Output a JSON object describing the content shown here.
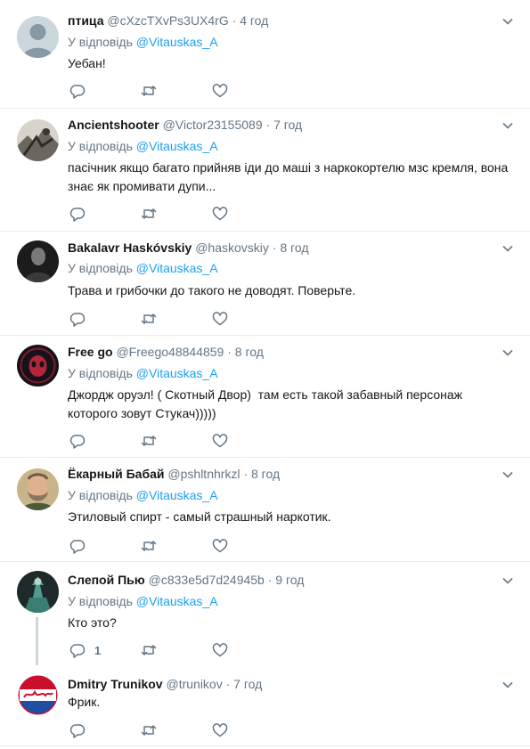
{
  "ui": {
    "reply_prefix": "У відповідь"
  },
  "tweets": [
    {
      "name": "птица",
      "handle": "@cXzcTXvPs3UX4rG",
      "time": "4 год",
      "reply_to": "@Vitauskas_A",
      "text_lines": [
        "Уебан!"
      ],
      "reply_count": "",
      "avatar": "default-avatar"
    },
    {
      "name": "Ancientshooter",
      "handle": "@Victor23155089",
      "time": "7 год",
      "reply_to": "@Vitauskas_A",
      "text_lines": [
        "пасічник якщо багато прийняв іди до маші з наркокортелю мзс кремля, вона",
        "знає як промивати дупи..."
      ],
      "reply_count": "",
      "avatar": "sketch-photo"
    },
    {
      "name": "Bakalavr Haskóvskiy",
      "handle": "@haskovskiy",
      "time": "8 год",
      "reply_to": "@Vitauskas_A",
      "text_lines": [
        "Трава и грибочки до такого не доводят. Поверьте."
      ],
      "reply_count": "",
      "avatar": "dark-portrait"
    },
    {
      "name": "Free go",
      "handle": "@Freego48844859",
      "time": "8 год",
      "reply_to": "@Vitauskas_A",
      "text_lines": [
        "Джордж оруэл! ( Скотный Двор)  там есть такой забавный персонаж",
        "которого зовут Стукач)))))"
      ],
      "reply_count": "",
      "avatar": "red-mask"
    },
    {
      "name": "Ёкарный Бабай",
      "handle": "@pshltnhrkzl",
      "time": "8 год",
      "reply_to": "@Vitauskas_A",
      "text_lines": [
        "Этиловый спирт - самый страшный наркотик."
      ],
      "reply_count": "",
      "avatar": "bearded-man"
    },
    {
      "name": "Слепой Пью",
      "handle": "@c833e5d7d24945b",
      "time": "9 год",
      "reply_to": "@Vitauskas_A",
      "text_lines": [
        "Кто это?"
      ],
      "reply_count": "1",
      "avatar": "green-figure"
    },
    {
      "name": "Dmitry Trunikov",
      "handle": "@trunikov",
      "time": "7 год",
      "reply_to": "",
      "text_lines": [
        "Фрик."
      ],
      "reply_count": "",
      "avatar": "pepsi-cola-logo"
    }
  ],
  "colors": {
    "link": "#1da1f2",
    "muted": "#657786",
    "text": "#14171a",
    "divider": "#e6ecf0"
  }
}
